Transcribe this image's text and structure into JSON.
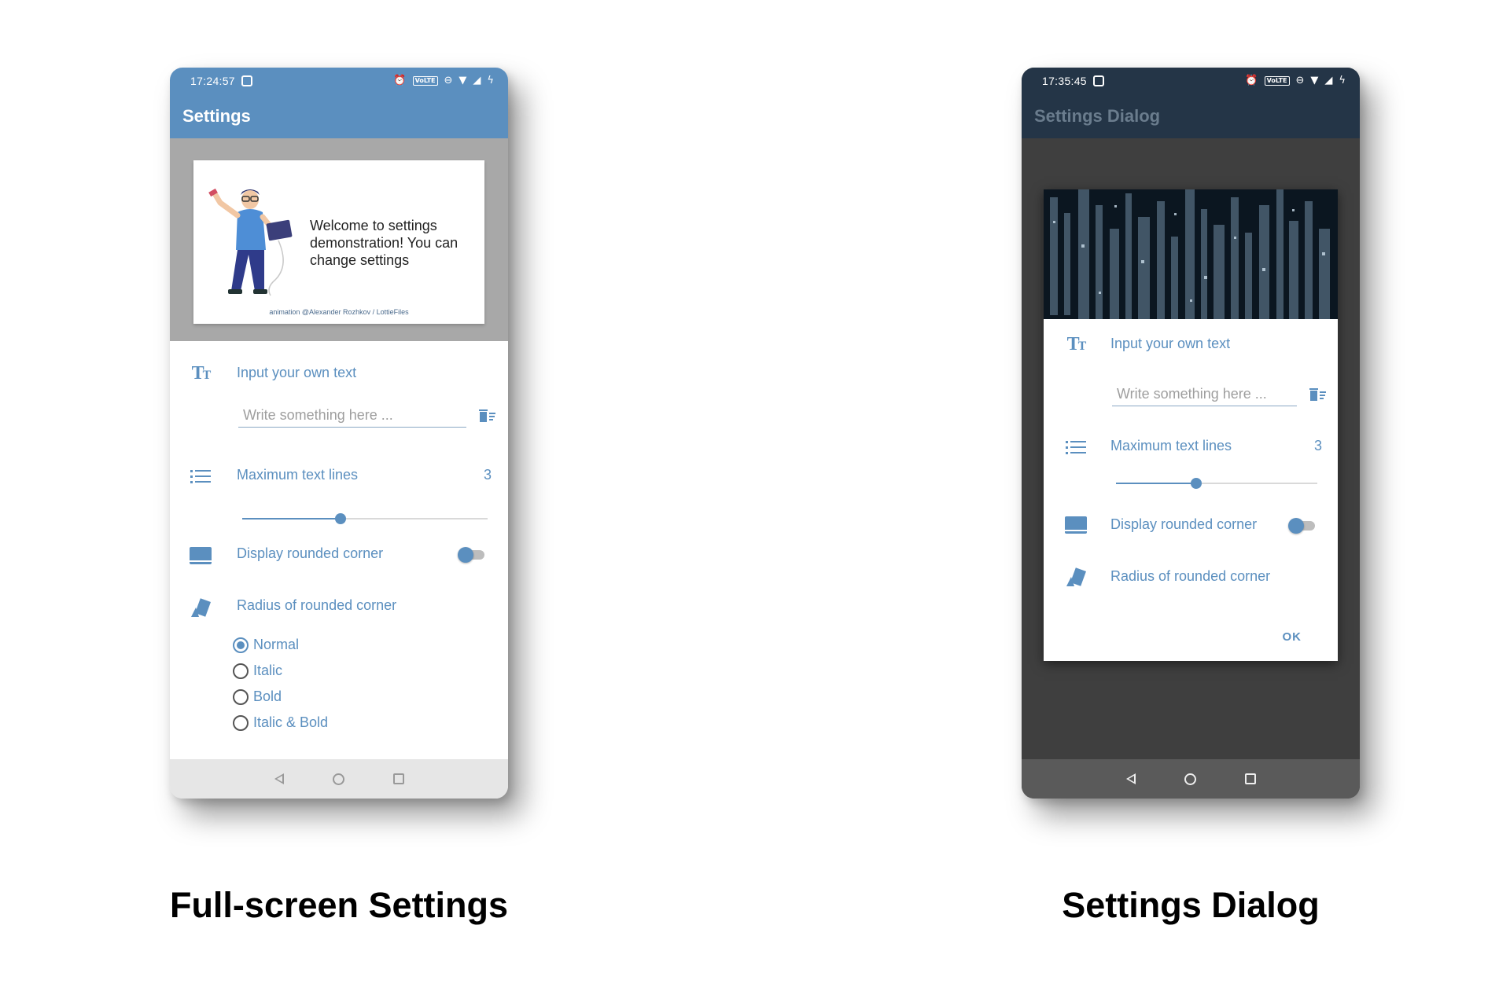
{
  "colors": {
    "accent": "#5b8fbf",
    "left_appbar": "#5b8fbf",
    "right_appbar": "#243547",
    "dialog_scrim": "#3f3f3f"
  },
  "left_phone": {
    "status": {
      "time": "17:24:57",
      "volte": "VoLTE"
    },
    "appbar_title": "Settings",
    "hero": {
      "text": "Welcome to settings demonstration! You can change settings",
      "credit": "animation @Alexander Rozhkov / LottieFiles"
    },
    "input_row": {
      "icon": "text-size-icon",
      "label": "Input your own text",
      "placeholder": "Write something here ..."
    },
    "lines_row": {
      "icon": "list-icon",
      "label": "Maximum text lines",
      "value": "3",
      "slider_fraction": 0.4
    },
    "corner_row": {
      "icon": "tablet-icon",
      "label": "Display rounded corner",
      "toggle_on": true
    },
    "radius_row": {
      "icon": "shapes-icon",
      "label": "Radius of rounded corner"
    },
    "radio_options": [
      "Normal",
      "Italic",
      "Bold",
      "Italic & Bold"
    ],
    "radio_selected": "Normal"
  },
  "right_phone": {
    "status": {
      "time": "17:35:45",
      "volte": "VoLTE"
    },
    "appbar_title": "Settings Dialog",
    "input_row": {
      "label": "Input your own text",
      "placeholder": "Write something here ..."
    },
    "lines_row": {
      "label": "Maximum text lines",
      "value": "3",
      "slider_fraction": 0.4
    },
    "corner_row": {
      "label": "Display rounded corner",
      "toggle_on": true
    },
    "radius_row": {
      "label": "Radius of rounded corner"
    },
    "ok_label": "OK"
  },
  "captions": {
    "left": "Full-screen Settings",
    "right": "Settings Dialog"
  }
}
